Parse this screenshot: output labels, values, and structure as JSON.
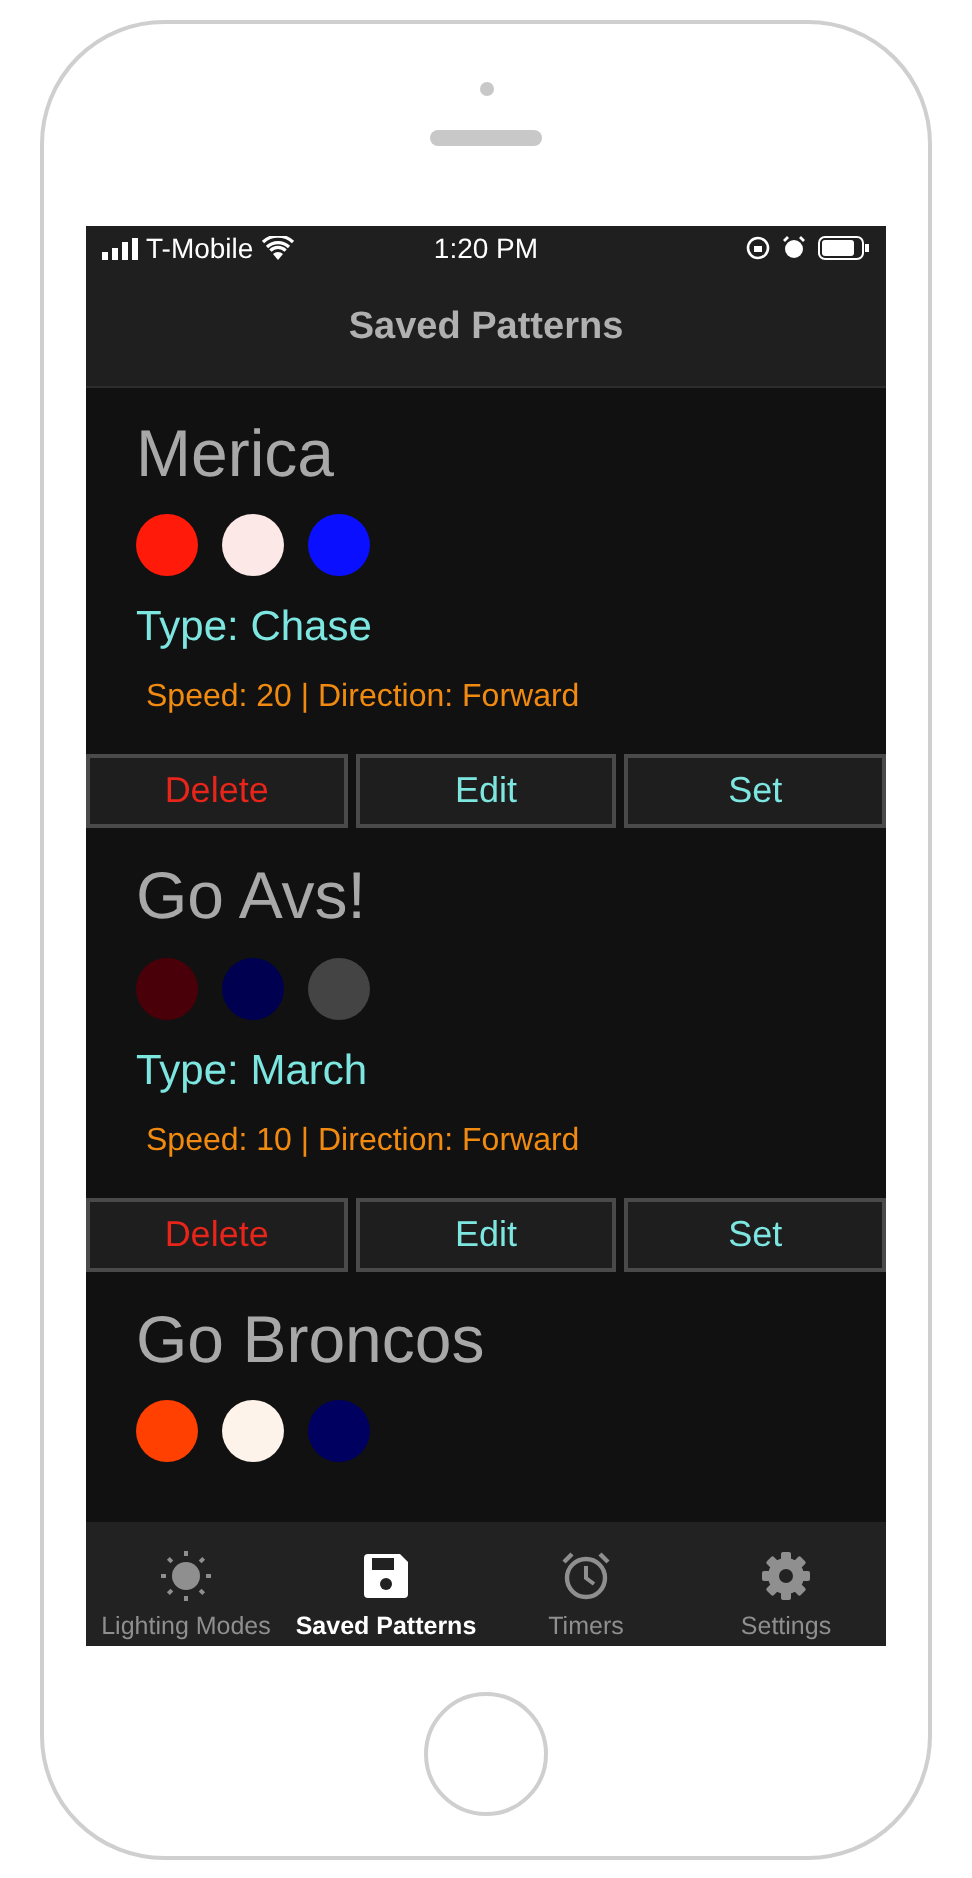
{
  "status_bar": {
    "carrier": "T-Mobile",
    "time": "1:20 PM"
  },
  "nav": {
    "title": "Saved Patterns"
  },
  "patterns": [
    {
      "name": "Merica",
      "colors": [
        {
          "color": "#ff1a0a"
        },
        {
          "color": "#fde8e8"
        },
        {
          "color": "#0a10ff"
        }
      ],
      "type": "Type: Chase",
      "details": "Speed: 20 | Direction: Forward",
      "buttons": [
        {
          "label": "Delete",
          "kind": "delete"
        },
        {
          "label": "Edit",
          "kind": "edit"
        },
        {
          "label": "Set",
          "kind": "set"
        }
      ]
    },
    {
      "name": "Go Avs!",
      "colors": [
        {
          "color": "#4a0008"
        },
        {
          "color": "#000050"
        },
        {
          "color": "#444444"
        }
      ],
      "type": "Type: March",
      "details": "Speed: 10 | Direction: Forward",
      "buttons": [
        {
          "label": "Delete",
          "kind": "delete"
        },
        {
          "label": "Edit",
          "kind": "edit"
        },
        {
          "label": "Set",
          "kind": "set"
        }
      ]
    },
    {
      "name": "Go Broncos",
      "colors": [
        {
          "color": "#ff4000"
        },
        {
          "color": "#fdf3ea"
        },
        {
          "color": "#000060"
        }
      ]
    }
  ],
  "tabs": [
    {
      "label": "Lighting Modes",
      "kind": "sun",
      "selected": false
    },
    {
      "label": "Saved Patterns",
      "kind": "save",
      "selected": true
    },
    {
      "label": "Timers",
      "kind": "alarm",
      "selected": false
    },
    {
      "label": "Settings",
      "kind": "gear",
      "selected": false
    }
  ]
}
